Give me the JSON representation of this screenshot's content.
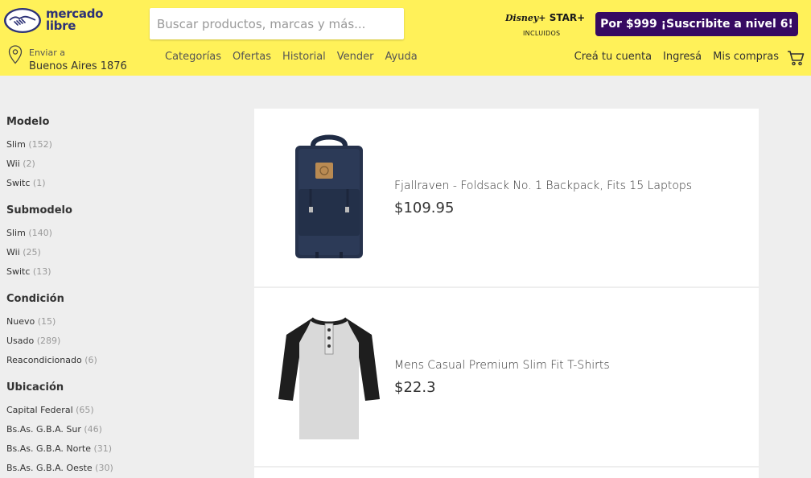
{
  "header": {
    "logo_line1": "mercado",
    "logo_line2": "libre",
    "search_placeholder": "Buscar productos, marcas y más...",
    "disney_brand": "Disney+",
    "star_brand": "STAR+",
    "disney_included": "INCLUIDOS",
    "promo": "Por $999 ¡Suscribite a nivel 6!",
    "location_label": "Enviar a",
    "location_address": "Buenos Aires 1876",
    "nav": [
      "Categorías",
      "Ofertas",
      "Historial",
      "Vender",
      "Ayuda"
    ],
    "user_nav": [
      "Creá tu cuenta",
      "Ingresá",
      "Mis compras"
    ],
    "colors": {
      "header_bg": "#fff159",
      "promo_bg": "#360a62",
      "brand_blue": "#2d3277"
    }
  },
  "filters": [
    {
      "title": "Modelo",
      "items": [
        {
          "label": "Slim",
          "count": "(152)"
        },
        {
          "label": "Wii",
          "count": "(2)"
        },
        {
          "label": "Switc",
          "count": "(1)"
        }
      ]
    },
    {
      "title": "Submodelo",
      "items": [
        {
          "label": "Slim",
          "count": "(140)"
        },
        {
          "label": "Wii",
          "count": "(25)"
        },
        {
          "label": "Switc",
          "count": "(13)"
        }
      ]
    },
    {
      "title": "Condición",
      "items": [
        {
          "label": "Nuevo",
          "count": "(15)"
        },
        {
          "label": "Usado",
          "count": "(289)"
        },
        {
          "label": "Reacondicionado",
          "count": "(6)"
        }
      ]
    },
    {
      "title": "Ubicación",
      "items": [
        {
          "label": "Capital Federal",
          "count": "(65)"
        },
        {
          "label": "Bs.As. G.B.A. Sur",
          "count": "(46)"
        },
        {
          "label": "Bs.As. G.B.A. Norte",
          "count": "(31)"
        },
        {
          "label": "Bs.As. G.B.A. Oeste",
          "count": "(30)"
        }
      ]
    }
  ],
  "products": [
    {
      "title": "Fjallraven - Foldsack No. 1 Backpack, Fits 15 Laptops",
      "price": "$109.95",
      "image": "backpack-image"
    },
    {
      "title": "Mens Casual Premium Slim Fit T-Shirts",
      "price": "$22.3",
      "image": "tshirt-image"
    }
  ]
}
